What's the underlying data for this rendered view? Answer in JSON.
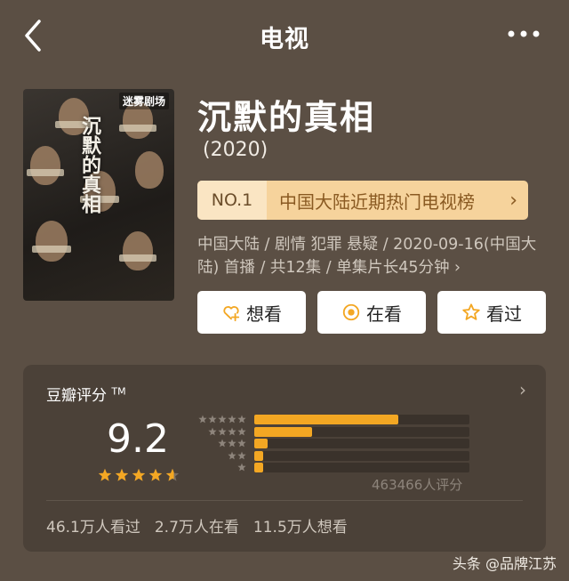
{
  "header": {
    "title": "电视",
    "back_icon": "chevron-left-icon",
    "more_icon": "more-dots-icon"
  },
  "poster": {
    "badge": "迷雾剧场",
    "calligraphy": "沉默的真相",
    "subtitle": ""
  },
  "show": {
    "title": "沉默的真相",
    "year": "(2020)"
  },
  "rank": {
    "no": "NO.1",
    "text": "中国大陆近期热门电视榜",
    "arrow": "›"
  },
  "meta": {
    "text": "中国大陆 / 剧情 犯罪 悬疑 / 2020-09-16(中国大陆) 首播 / 共12集 / 单集片长45分钟",
    "arrow": "›"
  },
  "actions": [
    {
      "label": "想看",
      "icon": "heart-plus-icon"
    },
    {
      "label": "在看",
      "icon": "radio-dot-icon"
    },
    {
      "label": "看过",
      "icon": "star-outline-icon"
    }
  ],
  "rating": {
    "title": "豆瓣评分",
    "tm": "TM",
    "score": "9.2",
    "stars_value": 4.6,
    "distribution": [
      0.67,
      0.27,
      0.06,
      0.04,
      0.04
    ],
    "count_text": "463466人评分",
    "stats": [
      "46.1万人看过",
      "2.7万人在看",
      "11.5万人想看"
    ]
  },
  "colors": {
    "background": "#5b4f44",
    "card": "#4b4138",
    "accent": "#f3a723",
    "rank_bg": "#f6d39c",
    "rank_text": "#8a5a22"
  },
  "watermark": "头条 @品牌江苏"
}
